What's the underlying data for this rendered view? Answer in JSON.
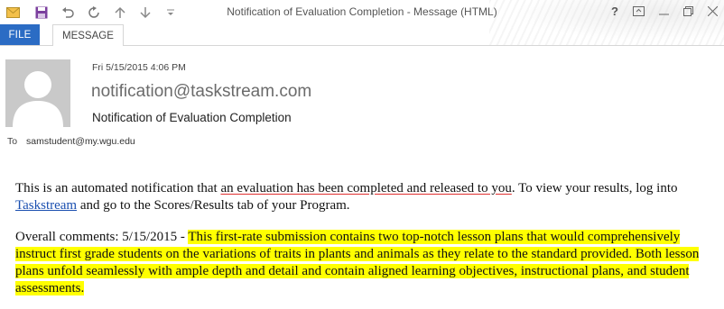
{
  "window": {
    "title": "Notification of Evaluation  Completion - Message (HTML)",
    "quick_access_icons": [
      "mail-icon",
      "save-icon",
      "undo-icon",
      "redo-icon",
      "up-arrow-icon",
      "down-arrow-icon",
      "customize-icon"
    ],
    "controls": [
      "help-icon",
      "ribbon-display-icon",
      "minimize-icon",
      "restore-icon",
      "close-icon"
    ]
  },
  "ribbon": {
    "file_label": "FILE",
    "message_label": "MESSAGE",
    "file_color": "#2b6cc4"
  },
  "header": {
    "date": "Fri 5/15/2015 4:06 PM",
    "sender": "notification@taskstream.com",
    "subject": "Notification of Evaluation  Completion",
    "to_label": "To",
    "to_value": "samstudent@my.wgu.edu"
  },
  "body": {
    "p1_part1": "This is an automated notification that ",
    "p1_underlined": "an evaluation has been completed and released to you",
    "p1_part2": ". To view your results, log into ",
    "link_text": "Taskstream",
    "p1_part3": " and go to the Scores/Results tab of your Program.",
    "p2_prefix": "Overall comments: 5/15/2015 - ",
    "p2_highlight": "This first-rate submission contains two top-notch lesson plans that would comprehensively instruct first grade students on the variations of traits in plants and animals as they relate to the standard provided. Both lesson plans unfold seamlessly with ample depth and detail and contain aligned learning objectives, instructional plans, and student assessments.",
    "highlight_color": "#ffff00",
    "link_color": "#1a4fb0"
  }
}
